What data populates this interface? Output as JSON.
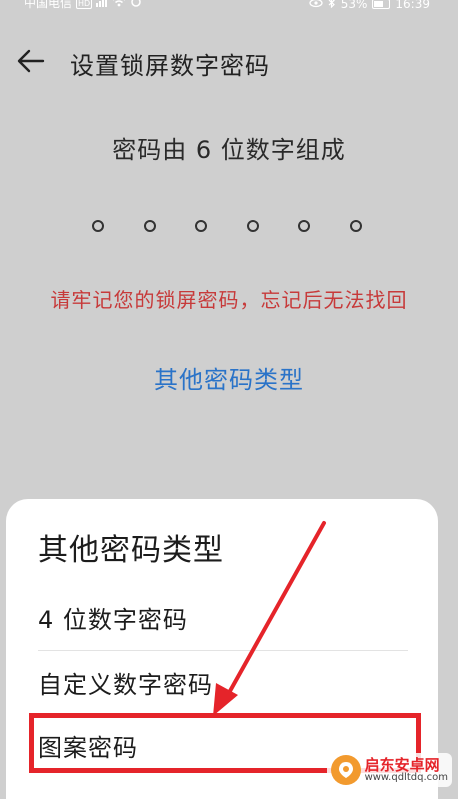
{
  "status_bar": {
    "carrier": "中国电信",
    "hd_badge": "HD",
    "battery": "53%",
    "time": "16:39"
  },
  "header": {
    "title": "设置锁屏数字密码"
  },
  "pin": {
    "description": "密码由 6 位数字组成",
    "length": 6,
    "warning": "请牢记您的锁屏密码，忘记后无法找回",
    "other_types_link": "其他密码类型"
  },
  "sheet": {
    "title": "其他密码类型",
    "options": [
      {
        "label": "4 位数字密码"
      },
      {
        "label": "自定义数字密码"
      },
      {
        "label": "图案密码"
      }
    ]
  },
  "watermark": {
    "name": "启东安卓网",
    "url": "www.qdltdq.com"
  },
  "colors": {
    "background": "#cfcfcf",
    "warning": "#c73a3a",
    "link": "#2a73c8",
    "annotation": "#e5242a",
    "sheet": "#ffffff"
  }
}
